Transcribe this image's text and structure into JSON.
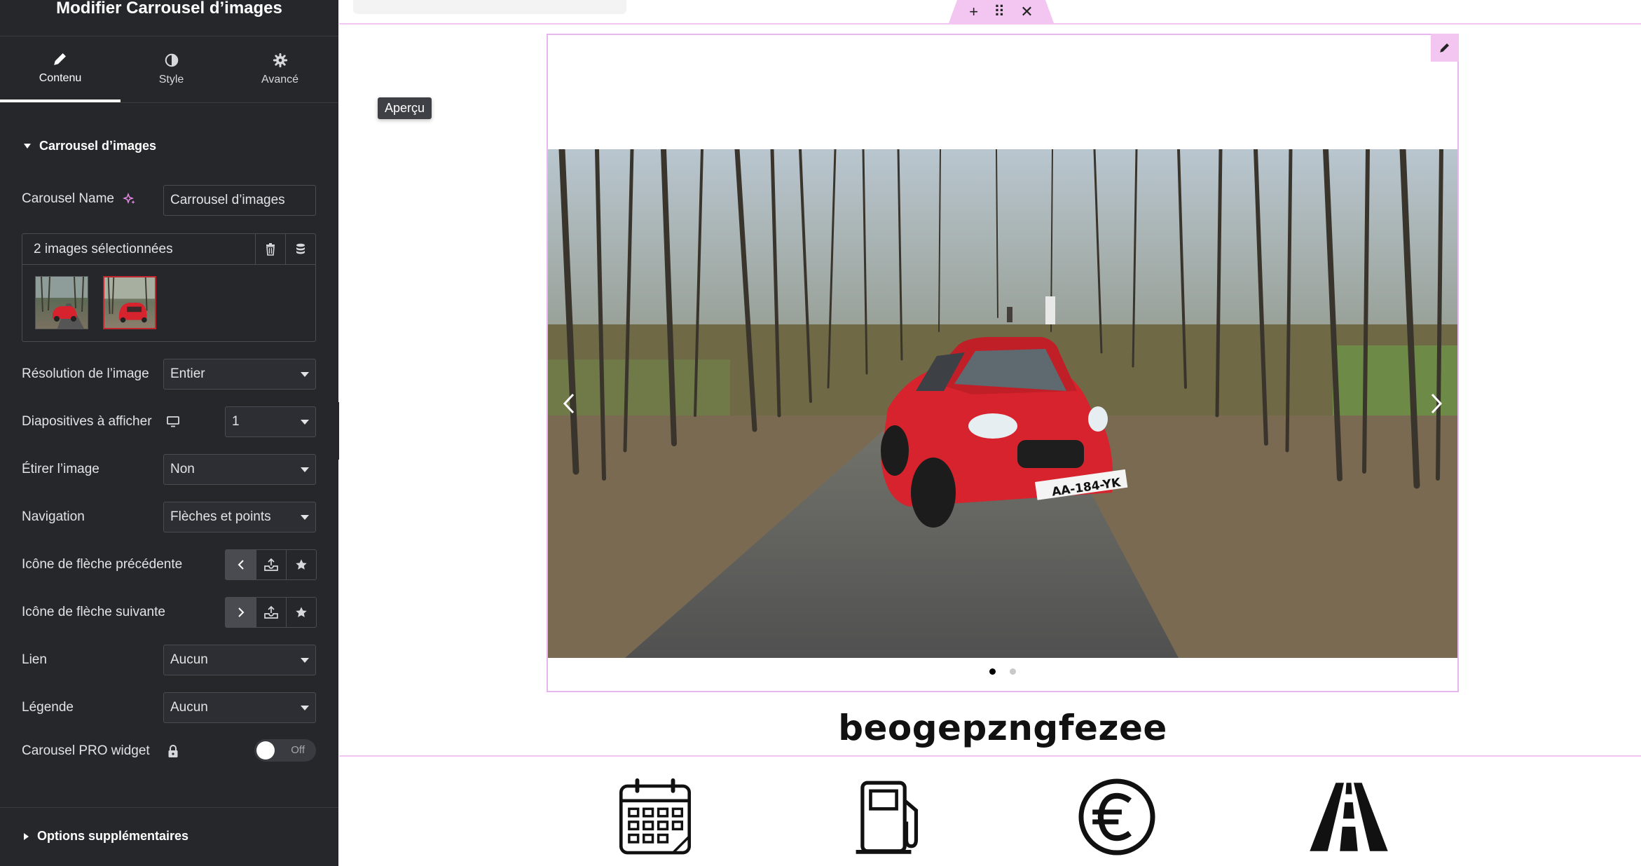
{
  "sidebar": {
    "title": "Modifier Carrousel d’images",
    "tabs": [
      {
        "label": "Contenu",
        "icon": "pencil-icon"
      },
      {
        "label": "Style",
        "icon": "contrast-icon"
      },
      {
        "label": "Avancé",
        "icon": "gear-icon"
      }
    ],
    "section_title": "Carrousel d’images",
    "carousel_name": {
      "label": "Carousel Name",
      "value": "Carrousel d’images"
    },
    "gallery": {
      "count_text": "2 images sélectionnées"
    },
    "image_resolution": {
      "label": "Résolution de l’image",
      "value": "Entier"
    },
    "slides_to_show": {
      "label": "Diapositives à afficher",
      "value": "1"
    },
    "stretch_image": {
      "label": "Étirer l’image",
      "value": "Non"
    },
    "navigation": {
      "label": "Navigation",
      "value": "Flèches et points"
    },
    "prev_arrow_icon": {
      "label": "Icône de flèche précédente"
    },
    "next_arrow_icon": {
      "label": "Icône de flèche suivante"
    },
    "link": {
      "label": "Lien",
      "value": "Aucun"
    },
    "caption": {
      "label": "Légende",
      "value": "Aucun"
    },
    "pro_widget": {
      "label": "Carousel PRO widget",
      "toggle_text": "Off"
    },
    "extra_options": "Options supplémentaires"
  },
  "canvas": {
    "section_handle": {
      "add": "+",
      "drag": "⠿",
      "close": "✕"
    },
    "tooltip": "Aperçu",
    "carousel": {
      "current_slide": 1,
      "total_slides": 2,
      "license_plate": "AA-184-YK"
    },
    "heading": "beogepzngfezee",
    "feature_icons": [
      "calendar-icon",
      "fuel-pump-icon",
      "euro-icon",
      "road-icon"
    ]
  },
  "colors": {
    "sidebar_bg": "#26272b",
    "accent_pink": "#f2c6f0",
    "car_red": "#d7232d"
  }
}
